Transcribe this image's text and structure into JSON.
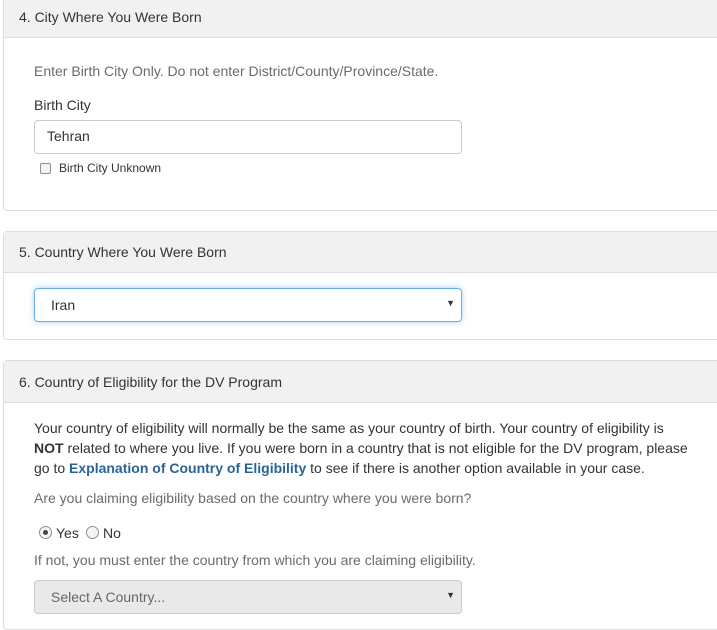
{
  "section4": {
    "heading": "4. City Where You Were Born",
    "help": "Enter Birth City Only. Do not enter District/County/Province/State.",
    "field_label": "Birth City",
    "field_value": "Tehran",
    "unknown_label": "Birth City Unknown"
  },
  "section5": {
    "heading": "5. Country Where You Were Born",
    "selected": "Iran"
  },
  "section6": {
    "heading": "6. Country of Eligibility for the DV Program",
    "para_line1": "Your country of eligibility will normally be the same as your country of birth. Your country of eligibility is",
    "para_not": "NOT",
    "para_line2_rest": " related to where you live. If you were born in a country that is not eligible for the DV program, please",
    "para_go_to": "go to ",
    "link_text": "Explanation of Country of Eligibility",
    "para_after_link": " to see if there is another option available in your case.",
    "question": "Are you claiming eligibility based on the country where you were born?",
    "yes_label": "Yes",
    "no_label": "No",
    "selected_option": "Yes",
    "if_not_text": "If not, you must enter the country from which you are claiming eligibility.",
    "country_select_placeholder": "Select A Country..."
  },
  "colors": {
    "link": "#2a6496",
    "focus_border": "#66afe9",
    "heading_bg": "#f1f1f1"
  }
}
